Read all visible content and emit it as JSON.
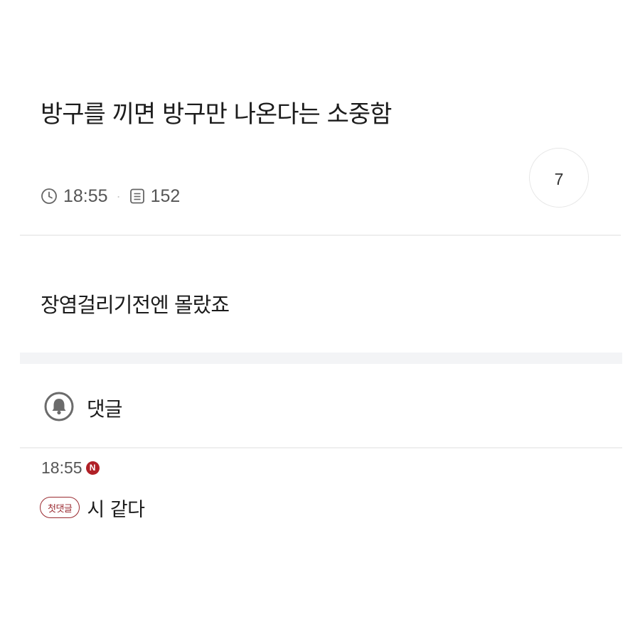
{
  "post": {
    "title": "방구를 끼면 방구만 나온다는 소중함",
    "time": "18:55",
    "views": "152",
    "recommend_count": "7",
    "body": "장염걸리기전엔 몰랐죠"
  },
  "comments_section": {
    "label": "댓글",
    "icon": "bell-icon"
  },
  "comments": [
    {
      "time": "18:55",
      "new_badge": "N",
      "tag": "첫댓글",
      "text": "시 같다"
    }
  ],
  "colors": {
    "accent": "#b02027",
    "tag": "#9a2a30",
    "divider": "#eeeeee",
    "band": "#f3f4f6"
  }
}
